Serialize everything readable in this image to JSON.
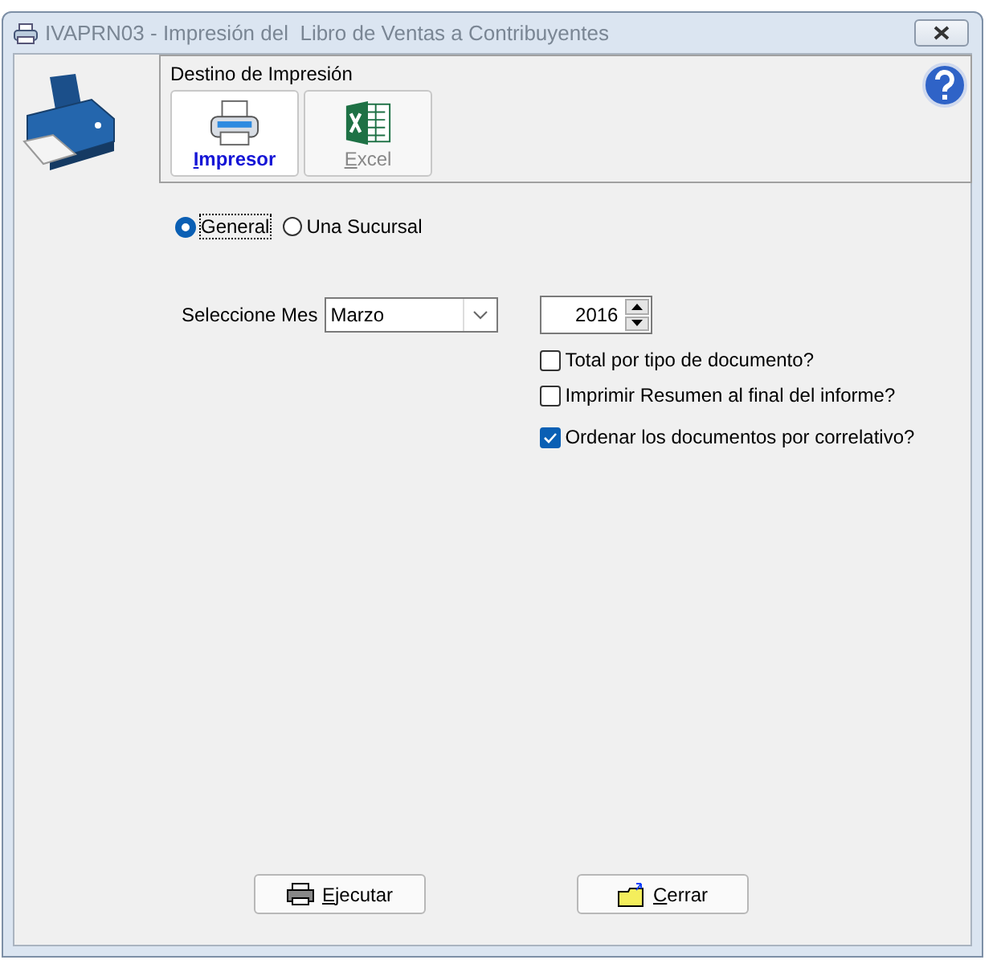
{
  "window": {
    "title": "IVAPRN03 - Impresión del  Libro de Ventas a Contribuyentes"
  },
  "destination": {
    "label": "Destino de Impresión",
    "options": [
      {
        "label": "Impresor",
        "kind": "printer",
        "selected": true
      },
      {
        "label": "Excel",
        "kind": "excel",
        "selected": false
      }
    ]
  },
  "scope": [
    {
      "label": "General",
      "selected": true
    },
    {
      "label": "Una Sucursal",
      "selected": false
    }
  ],
  "month": {
    "label": "Seleccione Mes",
    "value": "Marzo"
  },
  "year": {
    "value": "2016"
  },
  "options": [
    {
      "label": "Total por tipo de documento?",
      "checked": false
    },
    {
      "label": "Imprimir Resumen al final del informe?",
      "checked": false
    },
    {
      "label": "Ordenar los documentos por correlativo?",
      "checked": true
    }
  ],
  "buttons": [
    {
      "label": "Ejecutar",
      "kind": "run"
    },
    {
      "label": "Cerrar",
      "kind": "close"
    }
  ]
}
